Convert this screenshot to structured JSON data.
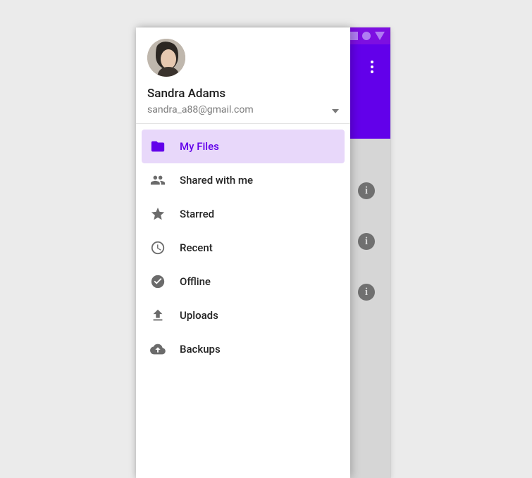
{
  "colors": {
    "primary": "#6200EA",
    "primary_dark": "#7D0FE1",
    "active_bg": "#E8D8FA"
  },
  "account": {
    "name": "Sandra Adams",
    "email": "sandra_a88@gmail.com"
  },
  "nav": {
    "items": [
      {
        "label": "My Files",
        "icon": "folder-icon",
        "active": true
      },
      {
        "label": "Shared with me",
        "icon": "people-icon",
        "active": false
      },
      {
        "label": "Starred",
        "icon": "star-icon",
        "active": false
      },
      {
        "label": "Recent",
        "icon": "clock-icon",
        "active": false
      },
      {
        "label": "Offline",
        "icon": "offline-pin-icon",
        "active": false
      },
      {
        "label": "Uploads",
        "icon": "upload-icon",
        "active": false
      },
      {
        "label": "Backups",
        "icon": "cloud-upload-icon",
        "active": false
      }
    ]
  }
}
